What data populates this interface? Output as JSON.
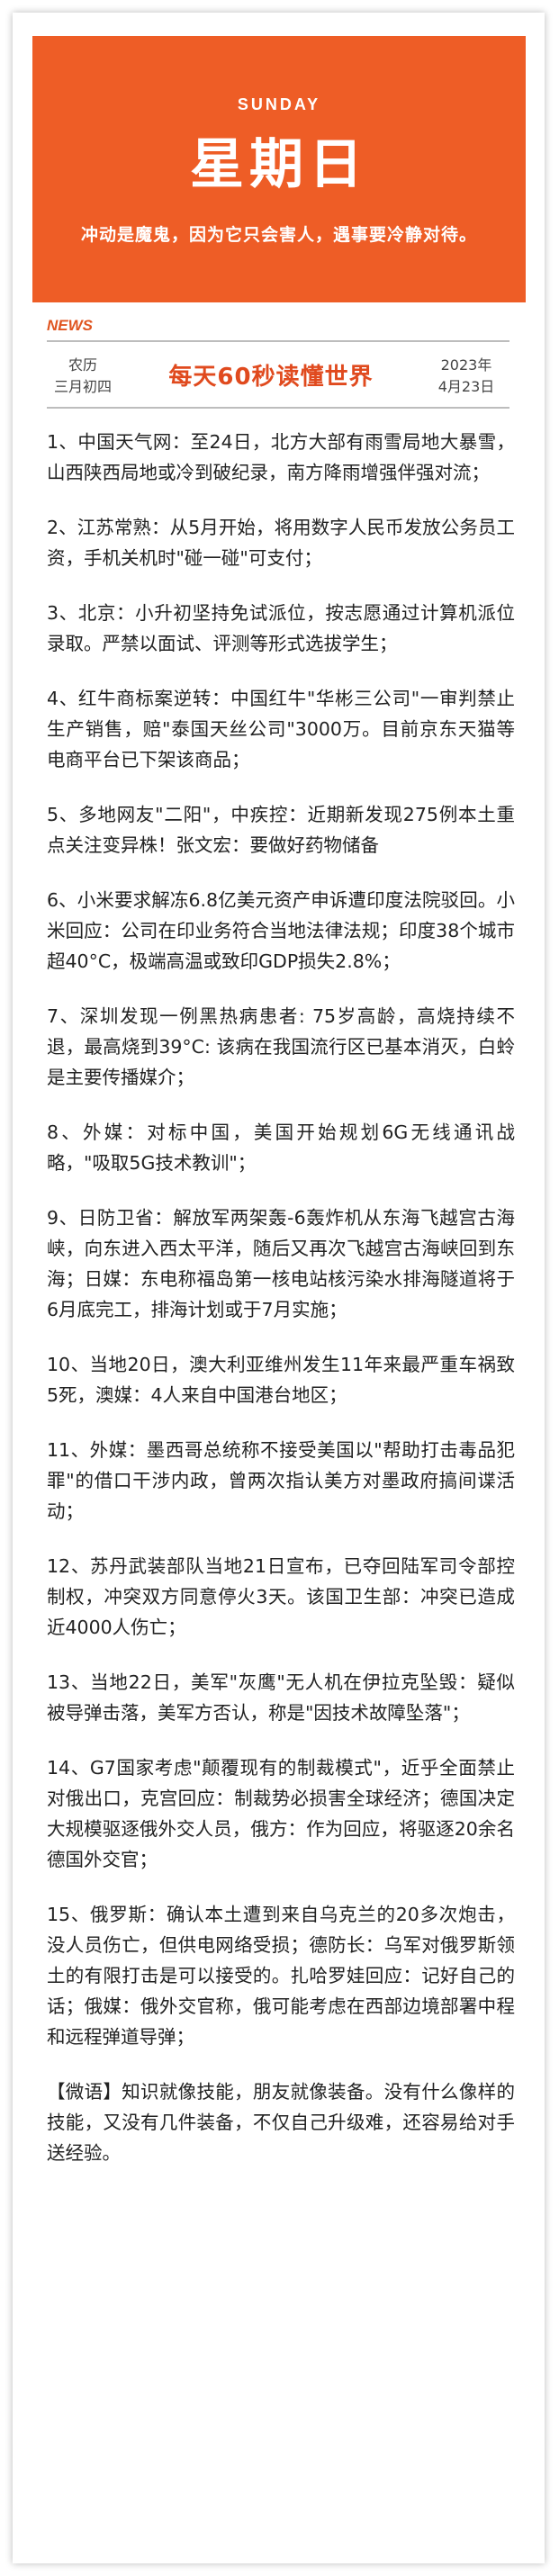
{
  "banner": {
    "day_en": "SUNDAY",
    "day_zh": "星期日",
    "motto": "冲动是魔鬼，因为它只会害人，遇事要冷静对待。",
    "bg_color": "#ee5d26"
  },
  "news_tag": "NEWS",
  "date": {
    "lunar_label": "农历",
    "lunar_date": "三月初四",
    "year": "2023年",
    "month_day": "4月23日"
  },
  "headline": "每天60秒读懂世界",
  "accent_color": "#e04a1e",
  "items": [
    "1、中国天气网：至24日，北方大部有雨雪局地大暴雪，山西陕西局地或冷到破纪录，南方降雨增强伴强对流；",
    "2、江苏常熟：从5月开始，将用数字人民币发放公务员工资，手机关机时\"碰一碰\"可支付；",
    "3、北京：小升初坚持免试派位，按志愿通过计算机派位录取。严禁以面试、评测等形式选拔学生；",
    "4、红牛商标案逆转：中国红牛\"华彬三公司\"一审判禁止生产销售，赔\"泰国天丝公司\"3000万。目前京东天猫等电商平台已下架该商品；",
    "5、多地网友\"二阳\"，中疾控：近期新发现275例本土重点关注变异株！张文宏：要做好药物储备",
    "6、小米要求解冻6.8亿美元资产申诉遭印度法院驳回。小米回应：公司在印业务符合当地法律法规；印度38个城市超40°C，极端高温或致印GDP损失2.8%；",
    "7、深圳发现一例黑热病患者: 75岁高龄，高烧持续不退，最高烧到39°C: 该病在我国流行区已基本消灭，白蛉是主要传播媒介；",
    "8、外媒：对标中国，美国开始规划6G无线通讯战略，\"吸取5G技术教训\"；",
    "9、日防卫省：解放军两架轰-6轰炸机从东海飞越宫古海峡，向东进入西太平洋，随后又再次飞越宫古海峡回到东海；日媒：东电称福岛第一核电站核污染水排海隧道将于6月底完工，排海计划或于7月实施；",
    "10、当地20日，澳大利亚维州发生11年来最严重车祸致5死，澳媒：4人来自中国港台地区；",
    "11、外媒：墨西哥总统称不接受美国以\"帮助打击毒品犯罪\"的借口干涉内政，曾两次指认美方对墨政府搞间谍活动；",
    "12、苏丹武装部队当地21日宣布，已夺回陆军司令部控制权，冲突双方同意停火3天。该国卫生部：冲突已造成近4000人伤亡；",
    "13、当地22日，美军\"灰鹰\"无人机在伊拉克坠毁：疑似被导弹击落，美军方否认，称是\"因技术故障坠落\"；",
    "14、G7国家考虑\"颠覆现有的制裁模式\"，近乎全面禁止对俄出口，克宫回应：制裁势必损害全球经济；德国决定大规模驱逐俄外交人员，俄方：作为回应，将驱逐20余名德国外交官；",
    "15、俄罗斯：确认本土遭到来自乌克兰的20多次炮击，没人员伤亡，但供电网络受损；德防长：乌军对俄罗斯领土的有限打击是可以接受的。扎哈罗娃回应：记好自己的话；俄媒：俄外交官称，俄可能考虑在西部边境部署中程和远程弹道导弹；",
    "【微语】知识就像技能，朋友就像装备。没有什么像样的技能，又没有几件装备，不仅自己升级难，还容易给对手送经验。"
  ]
}
